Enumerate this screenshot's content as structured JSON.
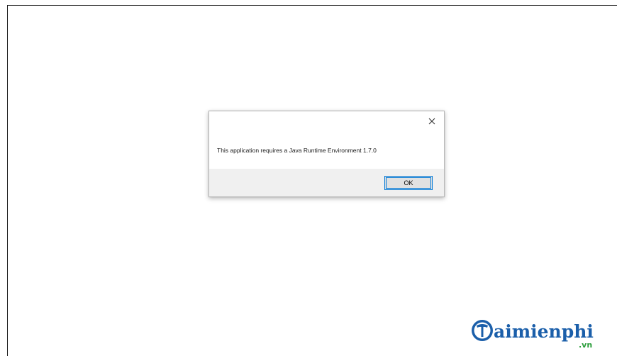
{
  "dialog": {
    "message": "This application requires a Java Runtime Environment 1.7.0",
    "ok_label": "OK",
    "close_symbol": "close-icon"
  },
  "watermark": {
    "brand": "Taimienphi",
    "tld": ".vn",
    "brand_color": "#1b5faa",
    "tld_color": "#2a9d3a"
  },
  "colors": {
    "button_focus_border": "#0078d7",
    "footer_bg": "#f0f0f0"
  }
}
